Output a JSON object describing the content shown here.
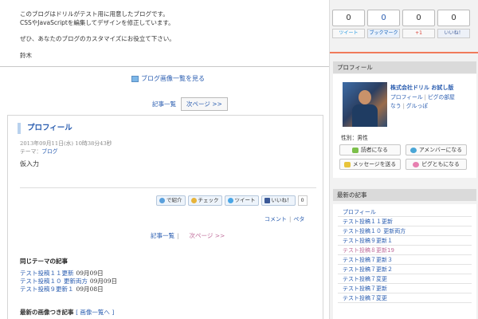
{
  "intro": {
    "line1": "このブログはドリルがテスト用に用意したブログです。",
    "line2": "CSSやJavaScriptを編集してデザインを修正しています。",
    "line3": "ぜひ、あなたのブログのカスタマイズにお役立て下さい。",
    "signature": "鈴木"
  },
  "image_list_link": "ブログ画像一覧を見る",
  "nav_top": {
    "list": "記事一覧",
    "next": "次ページ >>"
  },
  "article": {
    "title": "プロフィール",
    "date": "2013年09月11日(水) 10時38分43秒",
    "theme_label": "テーマ：",
    "theme": "ブログ",
    "body": "仮入力"
  },
  "share": {
    "intro": "で紹介",
    "check": "チェック",
    "tweet": "ツイート",
    "like": "いいね！",
    "like_count": "0"
  },
  "comment_row": {
    "comment": "コメント",
    "pet": "ペタ"
  },
  "nav_bottom": {
    "list": "記事一覧",
    "next": "次ページ >>"
  },
  "related": {
    "heading": "同じテーマの記事",
    "items": [
      {
        "title": "テスト投稿１１更新",
        "date": "09月09日"
      },
      {
        "title": "テスト投稿１０ 更新両方",
        "date": "09月09日"
      },
      {
        "title": "テスト投稿９更新１",
        "date": "09月08日"
      }
    ]
  },
  "latest_images": {
    "heading": "最新の画像つき記事",
    "link": "[ 画像一覧へ ]"
  },
  "sidebar": {
    "counters": [
      {
        "count": "0",
        "label": "ツイート"
      },
      {
        "count": "0",
        "label": "ブックマーク"
      },
      {
        "count": "0",
        "label": "+1"
      },
      {
        "count": "0",
        "label": "いいね！"
      }
    ],
    "profile": {
      "heading": "プロフィール",
      "name": "株式会社ドリル お試し版",
      "link1": "プロフィール",
      "link2": "ピグの部屋",
      "link3": "なう",
      "link4": "グルっぽ",
      "sex": "性別：男性",
      "buttons": [
        "読者になる",
        "アメンバーになる",
        "メッセージを送る",
        "ピグともになる"
      ]
    },
    "latest": {
      "heading": "最新の記事",
      "items": [
        "プロフィール",
        "テスト投稿１１更新",
        "テスト投稿１０ 更新両方",
        "テスト投稿９更新１",
        "テスト投稿８更新19",
        "テスト投稿７更新３",
        "テスト投稿７更新２",
        "テスト投稿７変更",
        "テスト投稿７更新",
        "テスト投稿７変更"
      ]
    }
  },
  "colors": {
    "link": "#2a5db0",
    "visited": "#c06c9a",
    "accent_line": "#f07a5a"
  }
}
